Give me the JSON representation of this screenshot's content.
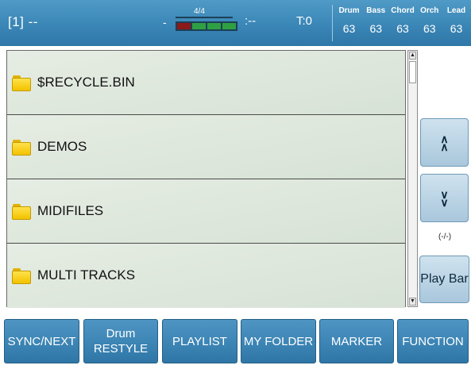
{
  "header": {
    "song_slot": "[1] --",
    "sig_dash": "-",
    "time_signature": "4/4",
    "beat_colors": [
      "#8b1a1a",
      "#2ea043",
      "#2ea043",
      "#2ea043"
    ],
    "counter": ":--",
    "tempo": "T:0",
    "mixer": [
      {
        "name": "Drum",
        "value": "63"
      },
      {
        "name": "Bass",
        "value": "63"
      },
      {
        "name": "Chord",
        "value": "63"
      },
      {
        "name": "Orch",
        "value": "63"
      },
      {
        "name": "Lead",
        "value": "63"
      }
    ]
  },
  "files": [
    {
      "name": "$RECYCLE.BIN",
      "icon": "folder-icon"
    },
    {
      "name": "DEMOS",
      "icon": "folder-icon"
    },
    {
      "name": "MIDIFILES",
      "icon": "folder-icon"
    },
    {
      "name": "MULTI TRACKS",
      "icon": "folder-icon"
    }
  ],
  "scrollbar": {
    "up_arrow": "▲",
    "down_arrow": "▼"
  },
  "side": {
    "page_up_icon": "chevron-up-double-icon",
    "page_down_icon": "chevron-down-double-icon",
    "page_indicator": "(-/-)",
    "play_bar_label": "Play Bar"
  },
  "function_buttons": [
    {
      "line1": "SYNC/NEXT",
      "line2": ""
    },
    {
      "line1": "Drum",
      "line2": "RESTYLE"
    },
    {
      "line1": "PLAYLIST",
      "line2": ""
    },
    {
      "line1": "MY FOLDER",
      "line2": ""
    },
    {
      "line1": "MARKER",
      "line2": ""
    },
    {
      "line1": "FUNCTION",
      "line2": ""
    }
  ],
  "colors": {
    "header_blue": "#3a86b6",
    "row_bg": "#dfe8dd",
    "button_blue": "#3a83b3",
    "folder_yellow": "#f2c200"
  }
}
